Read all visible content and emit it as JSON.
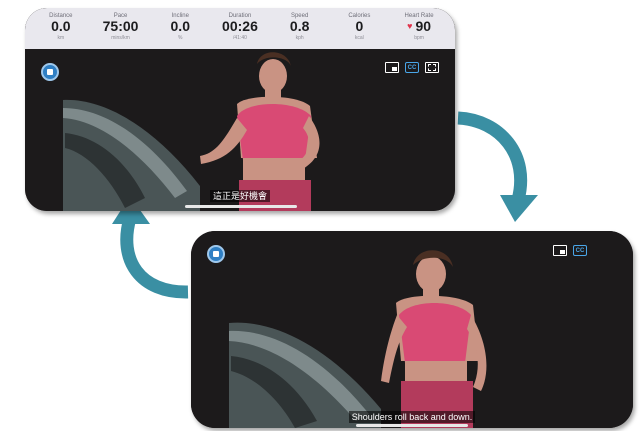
{
  "metrics": [
    {
      "label": "Distance",
      "value": "0.0",
      "unit": "km"
    },
    {
      "label": "Pace",
      "value": "75:00",
      "unit": "mins/km"
    },
    {
      "label": "Incline",
      "value": "0.0",
      "unit": "%"
    },
    {
      "label": "Duration",
      "value": "00:26",
      "unit": "/41:40"
    },
    {
      "label": "Speed",
      "value": "0.8",
      "unit": "kph"
    },
    {
      "label": "Calories",
      "value": "0",
      "unit": "kcal"
    },
    {
      "label": "Heart Rate",
      "value": "90",
      "unit": "bpm"
    }
  ],
  "icons": {
    "cc_label": "CC"
  },
  "captions": {
    "top": "這正是好機會",
    "bottom": "Shoulders roll back and down."
  },
  "colors": {
    "accent": "#2f7fc4",
    "arrow": "#3a8fa3",
    "shirt": "#d94a74",
    "heart": "#e0344c"
  }
}
